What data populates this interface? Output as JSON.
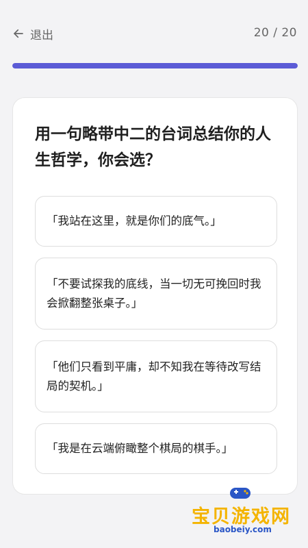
{
  "header": {
    "back_label": "退出",
    "counter": "20 / 20"
  },
  "progress": {
    "fraction": 1.0
  },
  "question": {
    "text": "用一句略带中二的台词总结你的人生哲学，你会选？"
  },
  "options": [
    {
      "text": "「我站在这里，就是你们的底气。」"
    },
    {
      "text": "「不要试探我的底线，当一切无可挽回时我会掀翻整张桌子。」"
    },
    {
      "text": "「他们只看到平庸，却不知我在等待改写结局的契机。」"
    },
    {
      "text": "「我是在云端俯瞰整个棋局的棋手。」"
    }
  ],
  "watermark": {
    "brand": "宝贝游戏网",
    "url": "baobeiy.com"
  },
  "colors": {
    "accent": "#5b5bd6",
    "background": "#f3f3f5"
  }
}
